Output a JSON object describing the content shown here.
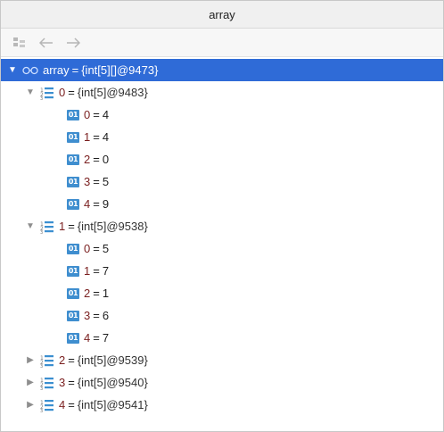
{
  "window": {
    "title": "array"
  },
  "toolbar": {
    "buttons": [
      {
        "icon": "copy-tree-icon"
      },
      {
        "icon": "back-arrow-icon"
      },
      {
        "icon": "forward-arrow-icon"
      }
    ]
  },
  "root": {
    "name": "array",
    "eq": "=",
    "value": "{int[5][]@9473}",
    "expanded": true
  },
  "rows": [
    {
      "name": "0",
      "value": "{int[5]@9483}",
      "expanded": true,
      "items": [
        {
          "name": "0",
          "value": "4"
        },
        {
          "name": "1",
          "value": "4"
        },
        {
          "name": "2",
          "value": "0"
        },
        {
          "name": "3",
          "value": "5"
        },
        {
          "name": "4",
          "value": "9"
        }
      ]
    },
    {
      "name": "1",
      "value": "{int[5]@9538}",
      "expanded": true,
      "items": [
        {
          "name": "0",
          "value": "5"
        },
        {
          "name": "1",
          "value": "7"
        },
        {
          "name": "2",
          "value": "1"
        },
        {
          "name": "3",
          "value": "6"
        },
        {
          "name": "4",
          "value": "7"
        }
      ]
    },
    {
      "name": "2",
      "value": "{int[5]@9539}",
      "expanded": false,
      "items": []
    },
    {
      "name": "3",
      "value": "{int[5]@9540}",
      "expanded": false,
      "items": []
    },
    {
      "name": "4",
      "value": "{int[5]@9541}",
      "expanded": false,
      "items": []
    }
  ],
  "eq_sign": "=",
  "badge_text": "01",
  "colors": {
    "selection": "#2f6bd7",
    "badge": "#3f8ecf",
    "name": "#7a1f1f",
    "list_icon": "#3b8fd0"
  }
}
